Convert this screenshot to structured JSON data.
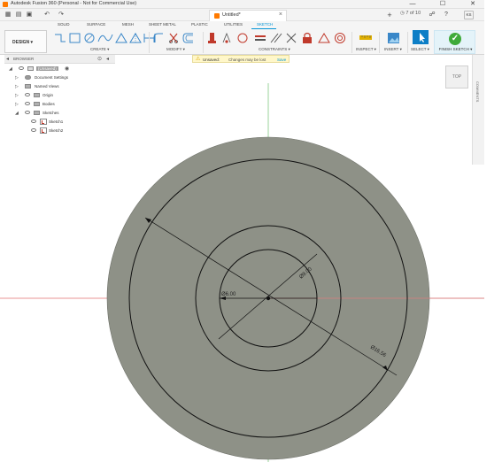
{
  "window": {
    "title": "Autodesk Fusion 360 (Personal - Not for Commercial Use)",
    "controls": [
      "—",
      "☐",
      "✕"
    ]
  },
  "qat": {
    "doc_tab": "Untitled*",
    "job_status": "7 of 10",
    "user_initials": "KS",
    "close": "×"
  },
  "ribbon": {
    "tabs": [
      "SOLID",
      "SURFACE",
      "MESH",
      "SHEET METAL",
      "PLASTIC",
      "UTILITIES",
      "SKETCH"
    ],
    "active_tab": "SKETCH",
    "workspace": "DESIGN ▾",
    "groups": [
      "CREATE ▾",
      "MODIFY ▾",
      "CONSTRAINTS ▾",
      "INSPECT ▾",
      "INSERT ▾",
      "SELECT ▾"
    ],
    "finish_sketch": "FINISH SKETCH ▾",
    "finish_check": "✓"
  },
  "browser": {
    "label": "BROWSER",
    "items": [
      {
        "label": "(Unsaved)",
        "arrow": "◢"
      },
      {
        "label": "Document Settings",
        "arrow": "▷"
      },
      {
        "label": "Named Views",
        "arrow": "▷"
      },
      {
        "label": "Origin",
        "arrow": "▷"
      },
      {
        "label": "Bodies",
        "arrow": "▷"
      },
      {
        "label": "Sketches",
        "arrow": "◢"
      },
      {
        "label": "Sketch1",
        "arrow": ""
      },
      {
        "label": "Sketch2",
        "arrow": ""
      }
    ]
  },
  "notice": {
    "icon": "⚠",
    "title": "Unsaved:",
    "message": "Changes may be lost",
    "action": "Save"
  },
  "viewcube": {
    "face": "TOP"
  },
  "right_panel": {
    "label": "COMMENTS"
  },
  "dimensions": {
    "inner": "Ø6.00",
    "middle": "Ø9.00",
    "outer": "Ø16.56"
  },
  "colors": {
    "accent": "#0696d7",
    "disc": "#8e9187",
    "finish": "#3eaa3a"
  }
}
